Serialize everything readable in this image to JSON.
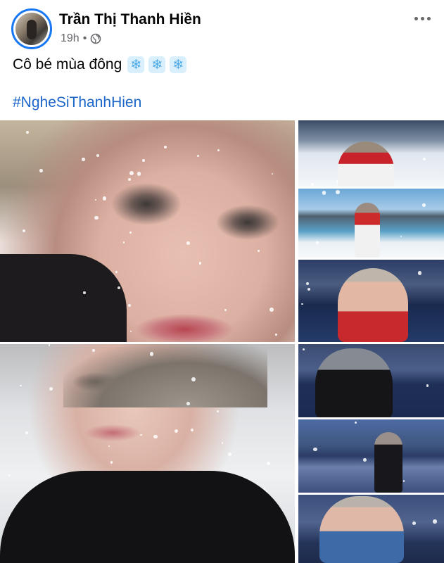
{
  "post": {
    "author": "Trần Thị Thanh Hiền",
    "time": "19h",
    "separator": "•",
    "caption": "Cô bé mùa đông",
    "snow_emoji": "❄",
    "hashtag": "#NgheSiThanhHien"
  },
  "icons": {
    "privacy": "globe-icon",
    "more": "more-options-icon",
    "snow": "snowflake-emoji-icon"
  },
  "colors": {
    "accent": "#1877f2",
    "hashtag": "#1b66c9",
    "meta_text": "#65676b",
    "text": "#050505"
  },
  "photos": {
    "count_visible": 8
  }
}
